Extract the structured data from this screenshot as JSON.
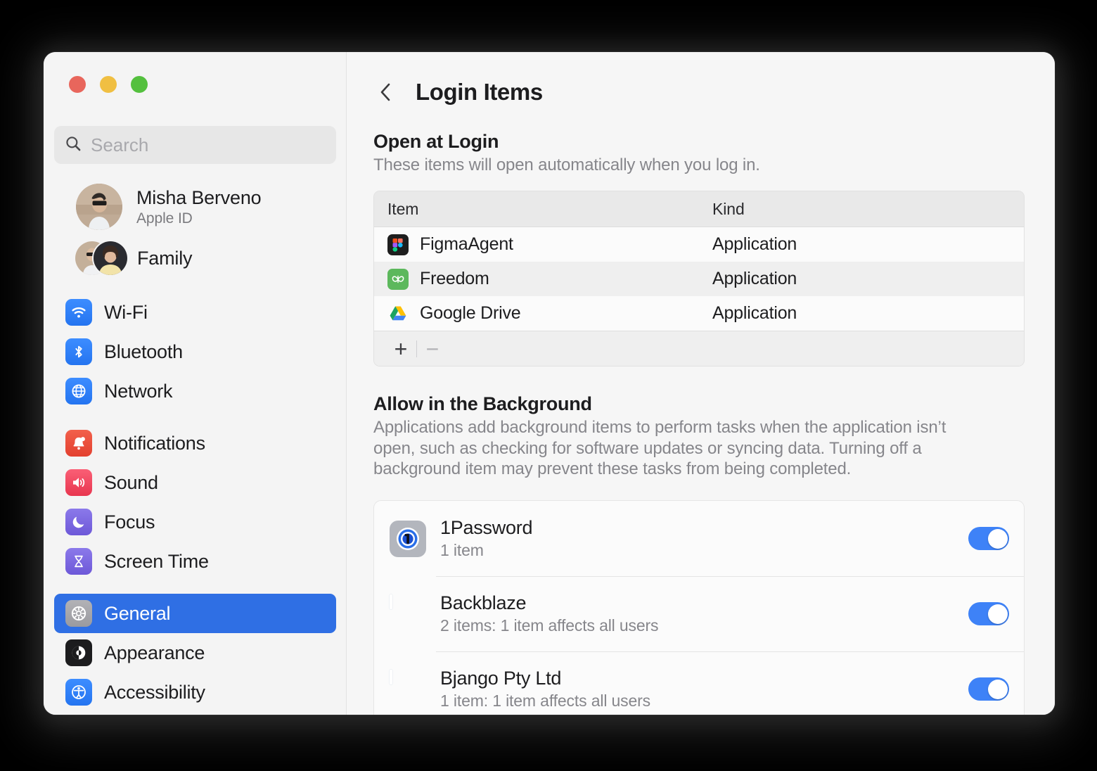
{
  "window": {
    "traffic_lights": [
      {
        "name": "close",
        "color": "#e8665c"
      },
      {
        "name": "minimize",
        "color": "#f0bf42"
      },
      {
        "name": "zoom",
        "color": "#54c03e"
      }
    ]
  },
  "sidebar": {
    "search": {
      "value": "",
      "placeholder": "Search"
    },
    "account": {
      "name": "Misha Berveno",
      "subtitle": "Apple ID"
    },
    "family": {
      "label": "Family"
    },
    "groups": [
      {
        "items": [
          {
            "label": "Wi-Fi",
            "icon": "wifi-icon",
            "selected": false
          },
          {
            "label": "Bluetooth",
            "icon": "bluetooth-icon",
            "selected": false
          },
          {
            "label": "Network",
            "icon": "network-icon",
            "selected": false
          }
        ]
      },
      {
        "items": [
          {
            "label": "Notifications",
            "icon": "bell-icon",
            "selected": false
          },
          {
            "label": "Sound",
            "icon": "speaker-icon",
            "selected": false
          },
          {
            "label": "Focus",
            "icon": "moon-icon",
            "selected": false
          },
          {
            "label": "Screen Time",
            "icon": "hourglass-icon",
            "selected": false
          }
        ]
      },
      {
        "items": [
          {
            "label": "General",
            "icon": "gear-icon",
            "selected": true
          },
          {
            "label": "Appearance",
            "icon": "appearance-icon",
            "selected": false
          },
          {
            "label": "Accessibility",
            "icon": "accessibility-icon",
            "selected": false
          }
        ]
      }
    ]
  },
  "main": {
    "back_label": "back-chevron",
    "title": "Login Items",
    "open_at_login": {
      "heading": "Open at Login",
      "description": "These items will open automatically when you log in.",
      "columns": [
        "Item",
        "Kind"
      ],
      "rows": [
        {
          "item": "FigmaAgent",
          "kind": "Application",
          "icon": "figma-icon",
          "selected": false
        },
        {
          "item": "Freedom",
          "kind": "Application",
          "icon": "freedom-icon",
          "selected": true
        },
        {
          "item": "Google Drive",
          "kind": "Application",
          "icon": "google-drive-icon",
          "selected": false
        }
      ],
      "add_label": "+",
      "remove_label": "−"
    },
    "allow_background": {
      "heading": "Allow in the Background",
      "description": "Applications add background items to perform tasks when the application isn’t open, such as checking for software updates or syncing data. Turning off a background item may prevent these tasks from being completed.",
      "apps": [
        {
          "name": "1Password",
          "sub": "1 item",
          "icon": "onepassword-icon",
          "enabled": true
        },
        {
          "name": "Backblaze",
          "sub": "2 items: 1 item affects all users",
          "icon": "generic-app-icon",
          "enabled": true
        },
        {
          "name": "Bjango Pty Ltd",
          "sub": "1 item: 1 item affects all users",
          "icon": "generic-app-icon",
          "enabled": true
        }
      ]
    }
  },
  "colors": {
    "accent": "#2f6fe4",
    "toggle_on": "#3e82f7",
    "sidebar_bg": "#f4f4f4",
    "main_bg": "#f6f6f6"
  }
}
